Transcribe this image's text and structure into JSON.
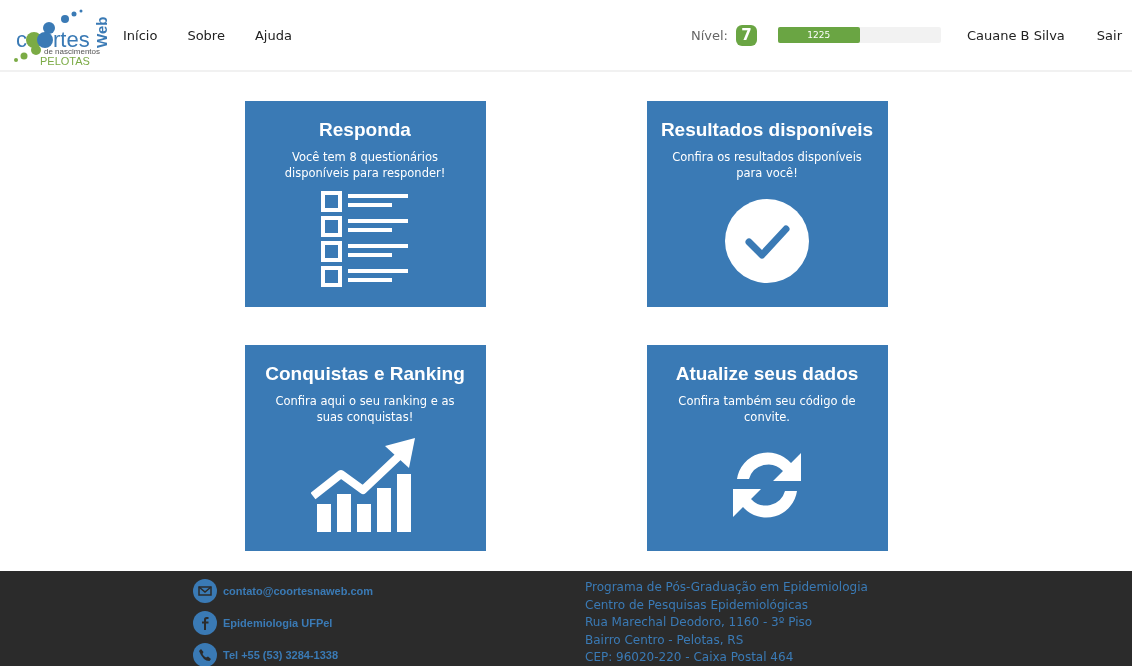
{
  "logo": {
    "prefix": "c",
    "suffix": "rtes",
    "subtitle": "de nascimentos",
    "city": "PELOTAS",
    "web": "Web"
  },
  "nav": [
    "Início",
    "Sobre",
    "Ajuda"
  ],
  "level": {
    "label": "Nível:",
    "value": "7"
  },
  "points": {
    "reading": "1225",
    "level": 0.5
  },
  "user": "Cauane B Silva",
  "logout": "Sair",
  "cards": [
    {
      "kind": "checklist",
      "title": "Responda",
      "text": "Você tem 8 questionários disponíveis para responder!"
    },
    {
      "kind": "check",
      "title": "Resultados disponíveis",
      "text": "Confira os resultados disponíveis para você!"
    },
    {
      "kind": "chart",
      "title": "Conquistas e Ranking",
      "text": "Confira aqui o seu ranking e as suas conquistas!"
    },
    {
      "kind": "refresh",
      "title": "Atualize seus dados",
      "text": "Confira também seu código de convite."
    }
  ],
  "footer": {
    "contacts": [
      {
        "kind": "mail",
        "text": "contato@coortesnaweb.com"
      },
      {
        "kind": "facebook",
        "text": "Epidemiologia UFPel"
      },
      {
        "kind": "phone",
        "text": "Tel +55 (53) 3284-1338"
      }
    ],
    "address": [
      "Programa de Pós-Graduação em Epidemiologia",
      "Centro de Pesquisas Epidemiológicas",
      "Rua Marechal Deodoro, 1160 - 3º Piso",
      "Bairro Centro - Pelotas, RS",
      "CEP: 96020-220 - Caixa Postal 464"
    ]
  }
}
